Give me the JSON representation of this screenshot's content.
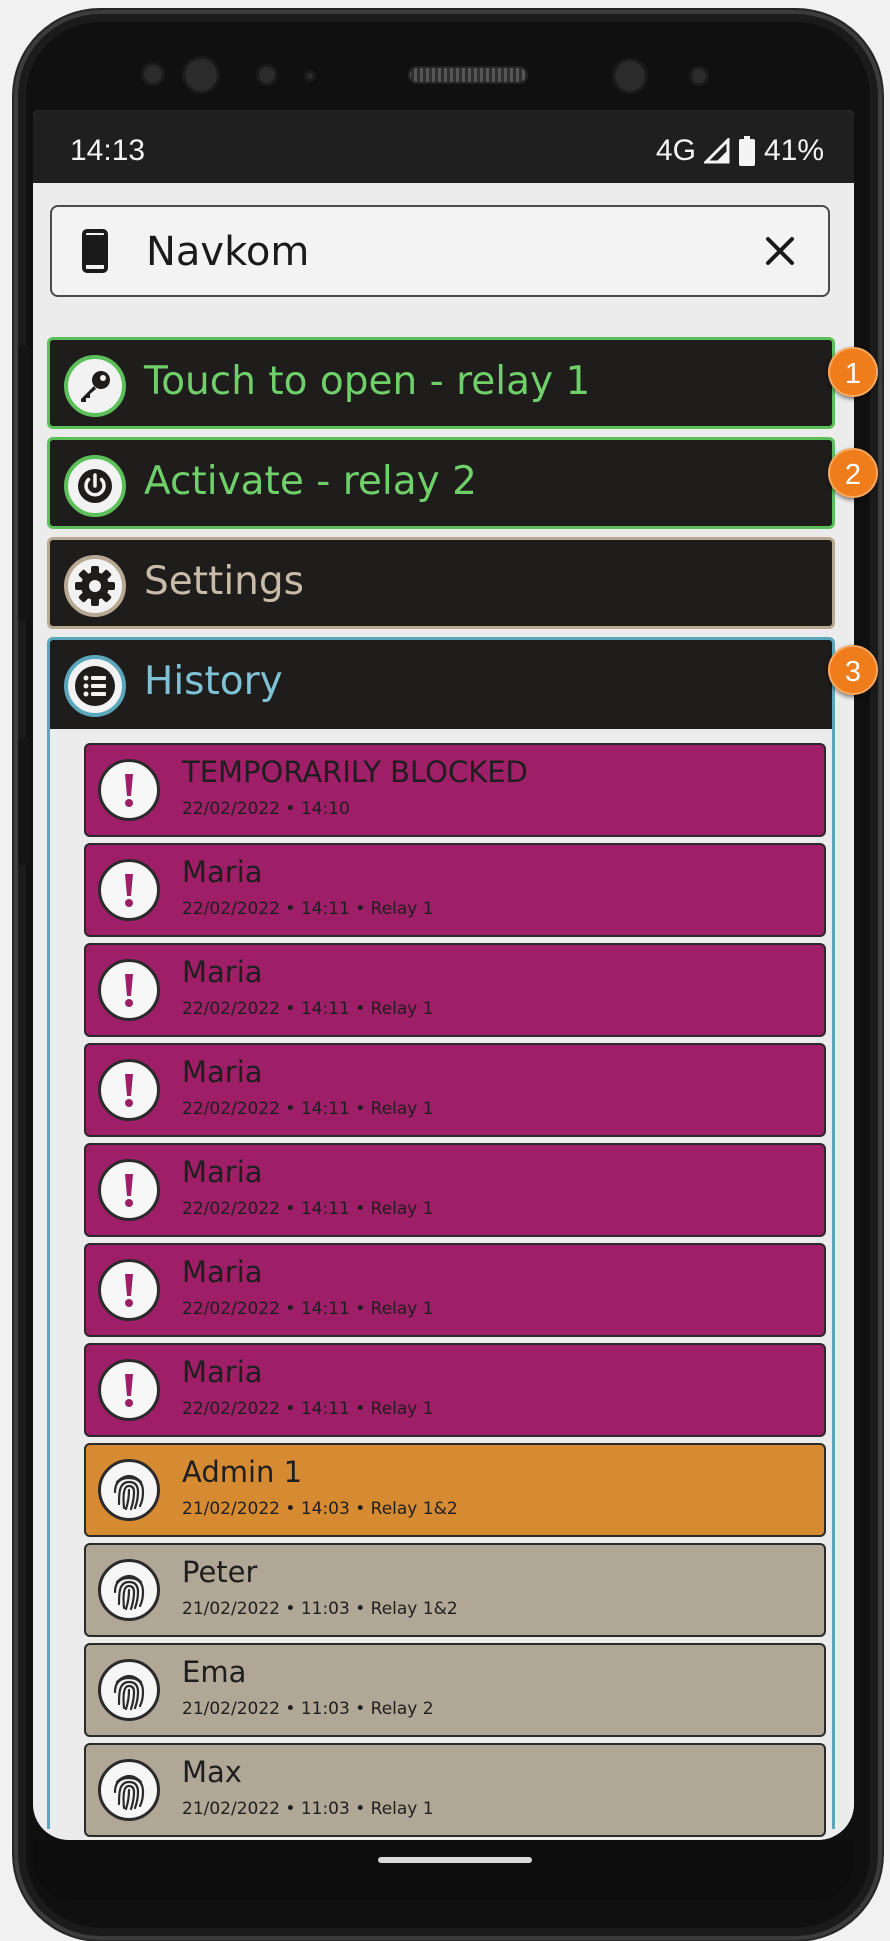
{
  "status_bar": {
    "time": "14:13",
    "network": "4G",
    "battery": "41%"
  },
  "title_bar": {
    "icon": "smartphone-icon",
    "title": "Navkom",
    "close_icon": "close-icon"
  },
  "menu": [
    {
      "label": "Touch to open - relay 1",
      "icon": "key-icon",
      "badge": "1"
    },
    {
      "label": "Activate - relay 2",
      "icon": "power-icon",
      "badge": "2"
    },
    {
      "label": "Settings",
      "icon": "gear-icon"
    },
    {
      "label": "History",
      "icon": "list-icon",
      "badge": "3"
    }
  ],
  "history": [
    {
      "name": "TEMPORARILY BLOCKED",
      "meta": "22/02/2022 • 14:10",
      "kind": "blocked",
      "icon": "exclamation-icon"
    },
    {
      "name": "Maria",
      "meta": "22/02/2022 • 14:11 • Relay 1",
      "kind": "blocked",
      "icon": "exclamation-icon"
    },
    {
      "name": "Maria",
      "meta": "22/02/2022 • 14:11 • Relay 1",
      "kind": "blocked",
      "icon": "exclamation-icon"
    },
    {
      "name": "Maria",
      "meta": "22/02/2022 • 14:11 • Relay 1",
      "kind": "blocked",
      "icon": "exclamation-icon"
    },
    {
      "name": "Maria",
      "meta": "22/02/2022 • 14:11 • Relay 1",
      "kind": "blocked",
      "icon": "exclamation-icon"
    },
    {
      "name": "Maria",
      "meta": "22/02/2022 • 14:11 • Relay 1",
      "kind": "blocked",
      "icon": "exclamation-icon"
    },
    {
      "name": "Maria",
      "meta": "22/02/2022 • 14:11 • Relay 1",
      "kind": "blocked",
      "icon": "exclamation-icon"
    },
    {
      "name": "Admin 1",
      "meta": "21/02/2022 • 14:03 • Relay 1&2",
      "kind": "admin",
      "icon": "fingerprint-icon"
    },
    {
      "name": "Peter",
      "meta": "21/02/2022 • 11:03 • Relay 1&2",
      "kind": "user",
      "icon": "fingerprint-icon"
    },
    {
      "name": "Ema",
      "meta": "21/02/2022 • 11:03 • Relay 2",
      "kind": "user",
      "icon": "fingerprint-icon"
    },
    {
      "name": "Max",
      "meta": "21/02/2022 • 11:03 • Relay 1",
      "kind": "user",
      "icon": "fingerprint-icon"
    }
  ],
  "colors": {
    "blocked": "#9e1e67",
    "admin": "#d68b33",
    "user": "#b0a796",
    "green_accent": "#5cc05a",
    "history_accent": "#5aa6bb",
    "badge": "#ef7d1c"
  }
}
